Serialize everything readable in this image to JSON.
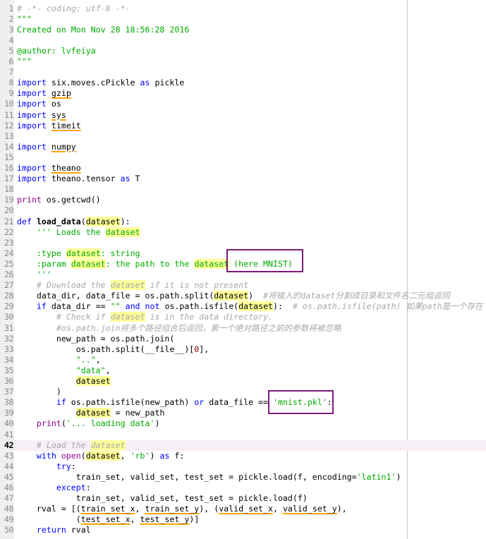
{
  "editor": {
    "current_line": 42,
    "colors": {
      "keyword": "#0000ff",
      "string": "#00aa00",
      "comment": "#a8a8a8",
      "builtin": "#900090",
      "number": "#800000",
      "occurrence_highlight": "#ffff99",
      "warning_underline": "#ffa500",
      "annotation_box": "#7a1b7a"
    },
    "lines": [
      {
        "n": "1",
        "tokens": [
          [
            "c",
            "# -*- coding: utf-8 -*-"
          ]
        ]
      },
      {
        "n": "2",
        "tokens": [
          [
            "s",
            "\"\"\""
          ]
        ]
      },
      {
        "n": "3",
        "tokens": [
          [
            "s",
            "Created on Mon Nov 28 18:56:28 2016"
          ]
        ]
      },
      {
        "n": "4",
        "tokens": []
      },
      {
        "n": "5",
        "tokens": [
          [
            "s",
            "@author: lvfeiya"
          ]
        ]
      },
      {
        "n": "6",
        "tokens": [
          [
            "s",
            "\"\"\""
          ]
        ]
      },
      {
        "n": "7",
        "tokens": []
      },
      {
        "n": "8",
        "tokens": [
          [
            "kw",
            "import"
          ],
          [
            "p",
            " six.moves.cPickle "
          ],
          [
            "kw",
            "as"
          ],
          [
            "p",
            " pickle"
          ]
        ]
      },
      {
        "n": "9",
        "tokens": [
          [
            "kw",
            "import"
          ],
          [
            "p",
            " "
          ],
          [
            "u",
            "gzip"
          ]
        ]
      },
      {
        "n": "10",
        "tokens": [
          [
            "kw",
            "import"
          ],
          [
            "p",
            " os"
          ]
        ]
      },
      {
        "n": "11",
        "tokens": [
          [
            "kw",
            "import"
          ],
          [
            "p",
            " "
          ],
          [
            "u",
            "sys"
          ]
        ]
      },
      {
        "n": "12",
        "tokens": [
          [
            "kw",
            "import"
          ],
          [
            "p",
            " "
          ],
          [
            "u",
            "timeit"
          ]
        ]
      },
      {
        "n": "13",
        "tokens": []
      },
      {
        "n": "14",
        "tokens": [
          [
            "kw",
            "import"
          ],
          [
            "p",
            " "
          ],
          [
            "u",
            "numpy"
          ]
        ]
      },
      {
        "n": "15",
        "tokens": []
      },
      {
        "n": "16",
        "tokens": [
          [
            "kw",
            "import"
          ],
          [
            "p",
            " "
          ],
          [
            "u",
            "theano"
          ]
        ]
      },
      {
        "n": "17",
        "tokens": [
          [
            "kw",
            "import"
          ],
          [
            "p",
            " theano.tensor "
          ],
          [
            "kw",
            "as"
          ],
          [
            "p",
            " T"
          ]
        ]
      },
      {
        "n": "18",
        "tokens": []
      },
      {
        "n": "19",
        "tokens": [
          [
            "b",
            "print"
          ],
          [
            "p",
            " os.getcwd()"
          ]
        ]
      },
      {
        "n": "20",
        "tokens": []
      },
      {
        "n": "21",
        "tokens": [
          [
            "kw",
            "def"
          ],
          [
            "p",
            " "
          ],
          [
            "d",
            "load_data"
          ],
          [
            "p",
            "("
          ],
          [
            "h",
            "dataset"
          ],
          [
            "p",
            "):"
          ]
        ]
      },
      {
        "n": "22",
        "tokens": [
          [
            "p",
            "    "
          ],
          [
            "s",
            "''' Loads the "
          ],
          [
            "s h",
            "dataset"
          ]
        ]
      },
      {
        "n": "23",
        "tokens": []
      },
      {
        "n": "24",
        "tokens": [
          [
            "p",
            "    "
          ],
          [
            "s",
            ":type "
          ],
          [
            "s h",
            "dataset"
          ],
          [
            "s",
            ": string"
          ]
        ]
      },
      {
        "n": "25",
        "tokens": [
          [
            "p",
            "    "
          ],
          [
            "s",
            ":param "
          ],
          [
            "s h",
            "dataset"
          ],
          [
            "s",
            ": the path to the "
          ],
          [
            "s h",
            "dataset"
          ],
          [
            "s",
            " (here MNIST)"
          ]
        ]
      },
      {
        "n": "26",
        "tokens": [
          [
            "p",
            "    "
          ],
          [
            "s",
            "'''"
          ]
        ]
      },
      {
        "n": "27",
        "tokens": [
          [
            "p",
            "    "
          ],
          [
            "c",
            "# Download the "
          ],
          [
            "c h",
            "dataset"
          ],
          [
            "c",
            " if it is not present"
          ]
        ]
      },
      {
        "n": "28",
        "tokens": [
          [
            "p",
            "    data_dir, data_file = os.path.split("
          ],
          [
            "h",
            "dataset"
          ],
          [
            "p",
            ")  "
          ],
          [
            "c",
            "#将输入的dataset分割成目录和文件名二元组返回"
          ]
        ]
      },
      {
        "n": "29",
        "tokens": [
          [
            "p",
            "    "
          ],
          [
            "kw",
            "if"
          ],
          [
            "p",
            " data_dir == "
          ],
          [
            "s",
            "\"\""
          ],
          [
            "p",
            " "
          ],
          [
            "kw",
            "and"
          ],
          [
            "p",
            " "
          ],
          [
            "kw",
            "not"
          ],
          [
            "p",
            " os.path.isfile("
          ],
          [
            "h",
            "dataset"
          ],
          [
            "p",
            "):  "
          ],
          [
            "c",
            "# os.path.isfile(path) 如果path是一个存在"
          ]
        ]
      },
      {
        "n": "30",
        "tokens": [
          [
            "p",
            "        "
          ],
          [
            "c",
            "# Check if "
          ],
          [
            "c h",
            "dataset"
          ],
          [
            "c",
            " is in the data directory."
          ]
        ]
      },
      {
        "n": "31",
        "tokens": [
          [
            "p",
            "        "
          ],
          [
            "c",
            "#os.path.join将多个路径组合后返回，第一个绝对路径之前的参数将被忽略"
          ]
        ]
      },
      {
        "n": "32",
        "tokens": [
          [
            "p",
            "        new_path = os.path.join("
          ]
        ]
      },
      {
        "n": "33",
        "tokens": [
          [
            "p",
            "            os.path.split(__file__)["
          ],
          [
            "n",
            "0"
          ],
          [
            "p",
            "],"
          ]
        ]
      },
      {
        "n": "34",
        "tokens": [
          [
            "p",
            "            "
          ],
          [
            "s",
            "\"..\""
          ],
          [
            "p",
            ","
          ]
        ]
      },
      {
        "n": "35",
        "tokens": [
          [
            "p",
            "            "
          ],
          [
            "s",
            "\"data\""
          ],
          [
            "p",
            ","
          ]
        ]
      },
      {
        "n": "36",
        "tokens": [
          [
            "p",
            "            "
          ],
          [
            "h",
            "dataset"
          ]
        ]
      },
      {
        "n": "37",
        "tokens": [
          [
            "p",
            "        )"
          ]
        ]
      },
      {
        "n": "38",
        "tokens": [
          [
            "p",
            "        "
          ],
          [
            "kw",
            "if"
          ],
          [
            "p",
            " os.path.isfile(new_path) "
          ],
          [
            "kw",
            "or"
          ],
          [
            "p",
            " data_file == "
          ],
          [
            "s",
            "'mnist.pkl'"
          ],
          [
            "p",
            ":"
          ]
        ]
      },
      {
        "n": "39",
        "tokens": [
          [
            "p",
            "            "
          ],
          [
            "h",
            "dataset"
          ],
          [
            "p",
            " = new_path"
          ]
        ]
      },
      {
        "n": "40",
        "tokens": [
          [
            "p",
            "    "
          ],
          [
            "b",
            "print"
          ],
          [
            "p",
            "("
          ],
          [
            "s",
            "'... loading data'"
          ],
          [
            "p",
            ")"
          ]
        ]
      },
      {
        "n": "41",
        "tokens": []
      },
      {
        "n": "42",
        "tokens": [
          [
            "p",
            "    "
          ],
          [
            "c",
            "# Load the "
          ],
          [
            "c h",
            "dataset"
          ]
        ]
      },
      {
        "n": "43",
        "tokens": [
          [
            "p",
            "    "
          ],
          [
            "kw",
            "with"
          ],
          [
            "p",
            " "
          ],
          [
            "b",
            "open"
          ],
          [
            "p",
            "("
          ],
          [
            "h",
            "dataset"
          ],
          [
            "p",
            ", "
          ],
          [
            "s",
            "'rb'"
          ],
          [
            "p",
            ") "
          ],
          [
            "kw",
            "as"
          ],
          [
            "p",
            " f:"
          ]
        ]
      },
      {
        "n": "44",
        "tokens": [
          [
            "p",
            "        "
          ],
          [
            "kw",
            "try"
          ],
          [
            "p",
            ":"
          ]
        ]
      },
      {
        "n": "45",
        "tokens": [
          [
            "p",
            "            train_set, valid_set, test_set = pickle.load(f, encoding="
          ],
          [
            "s",
            "'latin1'"
          ],
          [
            "p",
            ")"
          ]
        ]
      },
      {
        "n": "46",
        "tokens": [
          [
            "p",
            "        "
          ],
          [
            "kw",
            "except"
          ],
          [
            "p",
            ":"
          ]
        ]
      },
      {
        "n": "47",
        "tokens": [
          [
            "p",
            "            train_set, valid_set, test_set = pickle.load(f)"
          ]
        ]
      },
      {
        "n": "48",
        "tokens": [
          [
            "p",
            "    rval = [("
          ],
          [
            "u",
            "train_set_x"
          ],
          [
            "p",
            ", "
          ],
          [
            "u",
            "train_set_y"
          ],
          [
            "p",
            "), ("
          ],
          [
            "u",
            "valid_set_x"
          ],
          [
            "p",
            ", "
          ],
          [
            "u",
            "valid_set_y"
          ],
          [
            "p",
            "),"
          ]
        ]
      },
      {
        "n": "49",
        "tokens": [
          [
            "p",
            "            ("
          ],
          [
            "u",
            "test_set_x"
          ],
          [
            "p",
            ", "
          ],
          [
            "u",
            "test_set_y"
          ],
          [
            "p",
            ")]"
          ]
        ]
      },
      {
        "n": "50",
        "tokens": [
          [
            "p",
            "    "
          ],
          [
            "kw",
            "return"
          ],
          [
            "p",
            " rval"
          ]
        ]
      }
    ]
  }
}
